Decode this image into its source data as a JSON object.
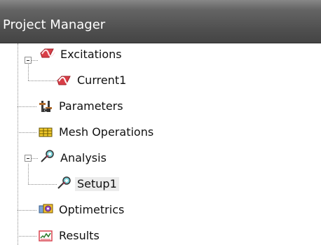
{
  "panel": {
    "title": "Project Manager"
  },
  "tree": {
    "items": [
      {
        "label": "Excitations",
        "icon": "excitation-icon",
        "expanded": true
      },
      {
        "label": "Current1",
        "icon": "current-icon"
      },
      {
        "label": "Parameters",
        "icon": "parameters-icon"
      },
      {
        "label": "Mesh Operations",
        "icon": "mesh-operations-icon"
      },
      {
        "label": "Analysis",
        "icon": "analysis-icon",
        "expanded": true
      },
      {
        "label": "Setup1",
        "icon": "setup-icon",
        "selected": true
      },
      {
        "label": "Optimetrics",
        "icon": "optimetrics-icon"
      },
      {
        "label": "Results",
        "icon": "results-icon"
      }
    ]
  },
  "colors": {
    "title_bar": "#555555",
    "title_text": "#ffffff",
    "background": "#ffffff",
    "tree_lines": "#8d8d8d",
    "selection_highlight": "#ececec"
  }
}
